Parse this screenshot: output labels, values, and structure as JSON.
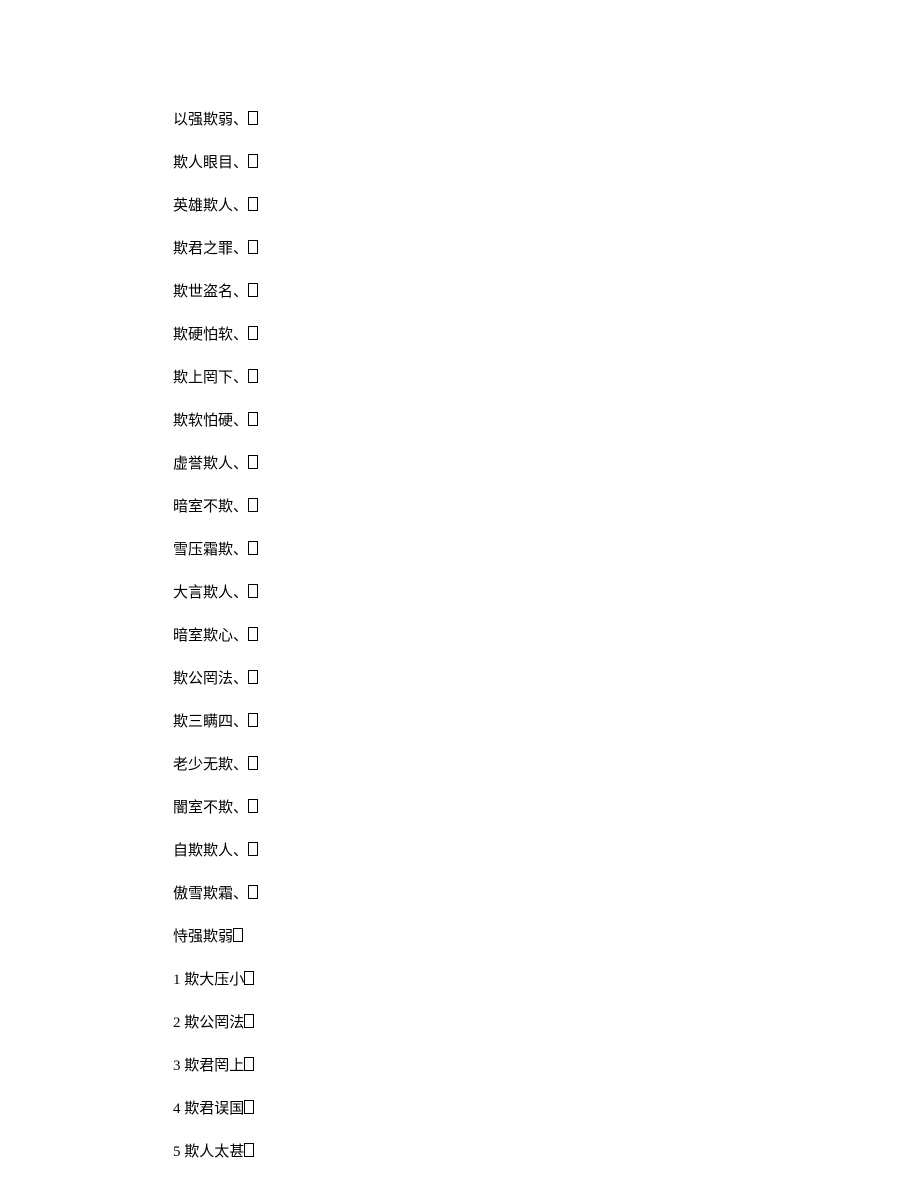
{
  "lines": [
    {
      "text": "以强欺弱、"
    },
    {
      "text": "欺人眼目、"
    },
    {
      "text": "英雄欺人、"
    },
    {
      "text": "欺君之罪、"
    },
    {
      "text": "欺世盗名、"
    },
    {
      "text": "欺硬怕软、"
    },
    {
      "text": "欺上罔下、"
    },
    {
      "text": "欺软怕硬、"
    },
    {
      "text": "虚誉欺人、"
    },
    {
      "text": "暗室不欺、"
    },
    {
      "text": "雪压霜欺、"
    },
    {
      "text": "大言欺人、"
    },
    {
      "text": "暗室欺心、"
    },
    {
      "text": "欺公罔法、"
    },
    {
      "text": "欺三瞒四、"
    },
    {
      "text": "老少无欺、"
    },
    {
      "text": "闇室不欺、"
    },
    {
      "text": "自欺欺人、"
    },
    {
      "text": "傲雪欺霜、"
    },
    {
      "text": "恃强欺弱"
    }
  ],
  "numbered": [
    {
      "num": "1",
      "text": "欺大压小"
    },
    {
      "num": "2",
      "text": "欺公罔法"
    },
    {
      "num": "3",
      "text": "欺君罔上"
    },
    {
      "num": "4",
      "text": "欺君误国"
    },
    {
      "num": "5",
      "text": "欺人太甚"
    }
  ]
}
